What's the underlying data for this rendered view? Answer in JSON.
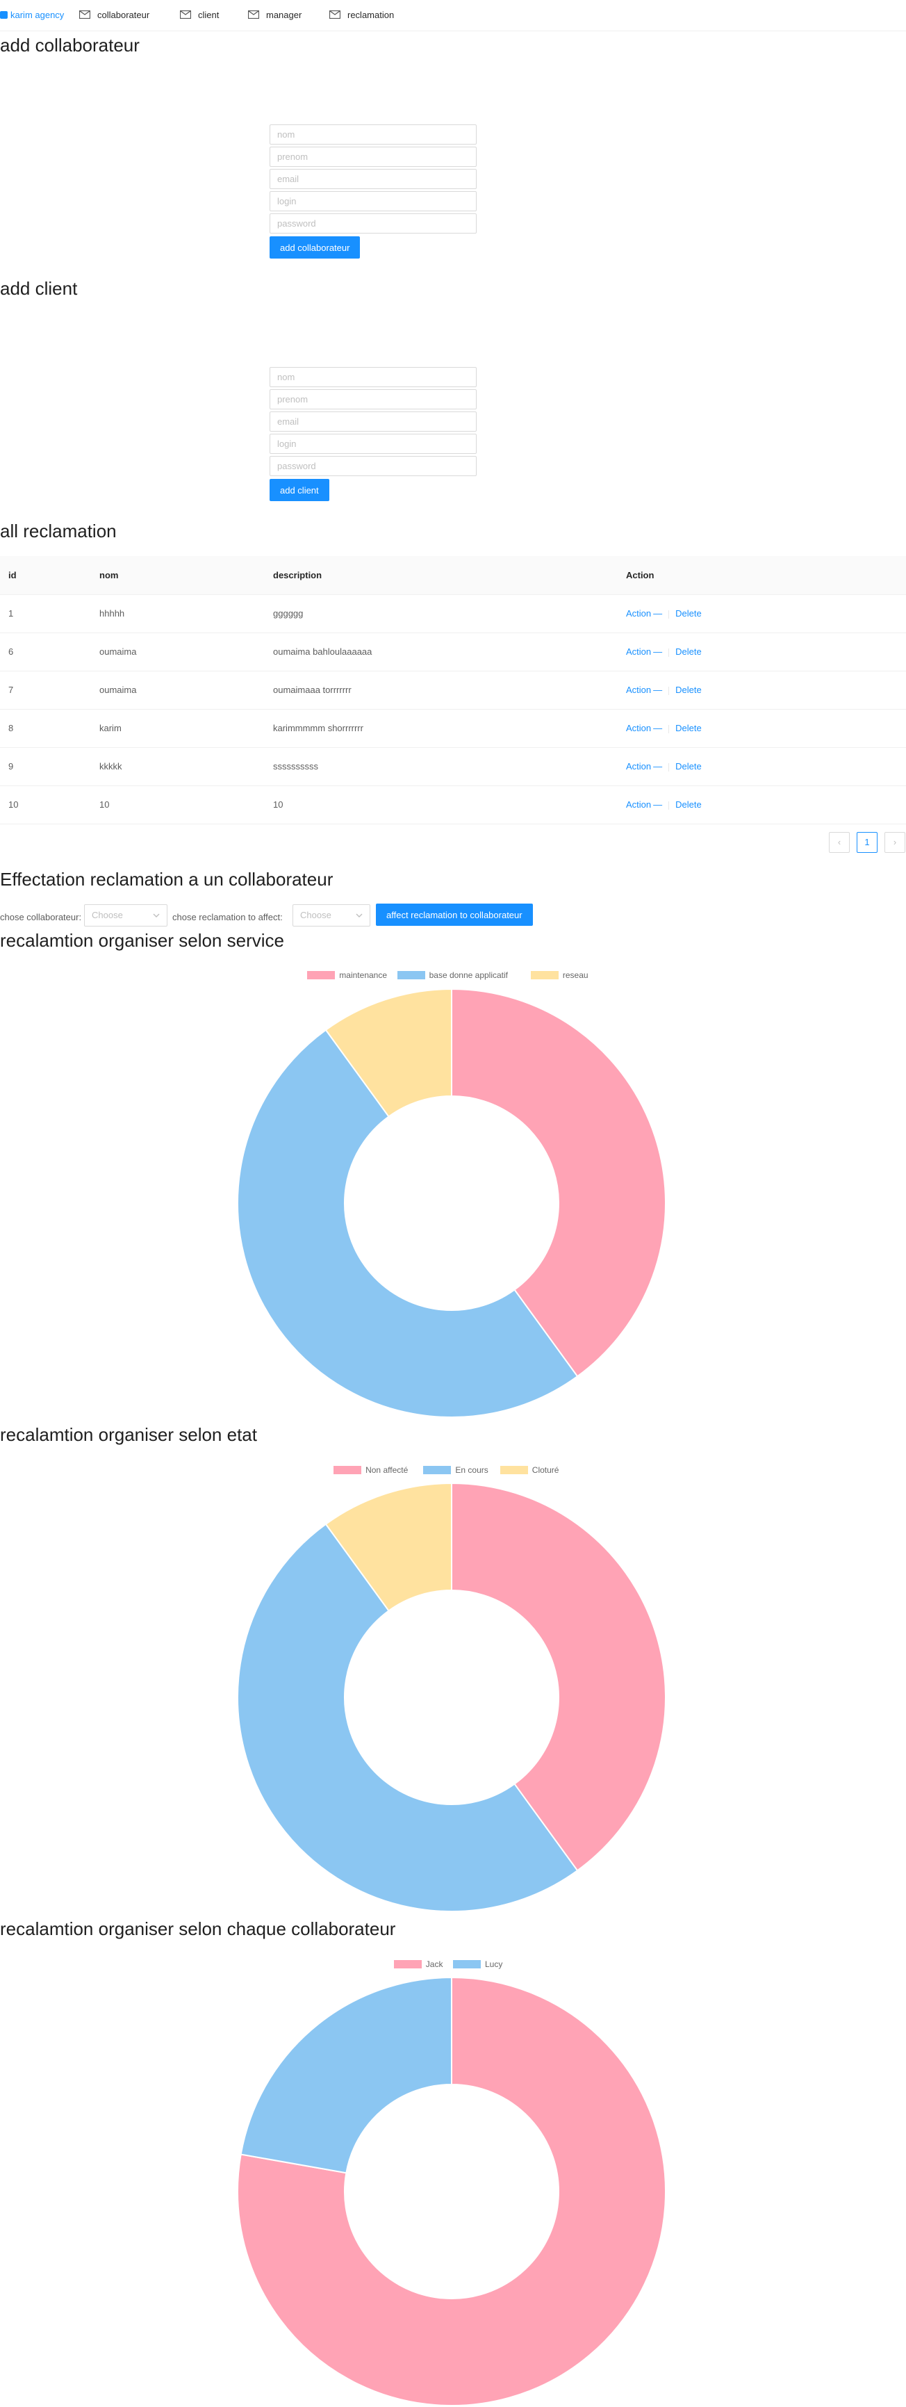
{
  "nav": {
    "brand": "karim agency",
    "items": [
      "collaborateur",
      "client",
      "manager",
      "reclamation"
    ]
  },
  "collab_form": {
    "title": "add collaborateur",
    "placeholders": {
      "nom": "nom",
      "prenom": "prenom",
      "email": "email",
      "login": "login",
      "password": "password"
    },
    "button": "add collaborateur"
  },
  "client_form": {
    "title": "add client",
    "placeholders": {
      "nom": "nom",
      "prenom": "prenom",
      "email": "email",
      "login": "login",
      "password": "password"
    },
    "button": "add client"
  },
  "reclamations": {
    "title": "all reclamation",
    "headers": {
      "id": "id",
      "nom": "nom",
      "description": "description",
      "action": "Action"
    },
    "action_label": "Action",
    "ellipsis": "—",
    "delete_label": "Delete",
    "rows": [
      {
        "id": "1",
        "nom": "hhhhh",
        "description": "gggggg"
      },
      {
        "id": "6",
        "nom": "oumaima",
        "description": "oumaima bahloulaaaaaa"
      },
      {
        "id": "7",
        "nom": "oumaima",
        "description": "oumaimaaa torrrrrrr"
      },
      {
        "id": "8",
        "nom": "karim",
        "description": "karimmmmm shorrrrrrr"
      },
      {
        "id": "9",
        "nom": "kkkkk",
        "description": "ssssssssss"
      },
      {
        "id": "10",
        "nom": "10",
        "description": "10"
      }
    ],
    "pagination": {
      "current": "1",
      "prev": "‹",
      "next": "›"
    }
  },
  "affectation": {
    "title": "Effectation reclamation a un collaborateur",
    "collab_label": "chose collaborateur:",
    "reclamation_label": "chose reclamation to affect:",
    "select_placeholder": "Choose",
    "button": "affect reclamation to collaborateur"
  },
  "chart_data": [
    {
      "type": "pie",
      "title": "recalamtion organiser selon service",
      "categories": [
        "maintenance",
        "base donne applicatif",
        "reseau"
      ],
      "values": [
        4,
        5,
        1
      ],
      "colors": [
        "#ffa3b5",
        "#8bc6f2",
        "#ffe29f"
      ]
    },
    {
      "type": "pie",
      "title": "recalamtion organiser selon etat",
      "categories": [
        "Non affecté",
        "En cours",
        "Cloturé"
      ],
      "values": [
        4,
        5,
        1
      ],
      "colors": [
        "#ffa3b5",
        "#8bc6f2",
        "#ffe29f"
      ]
    },
    {
      "type": "pie",
      "title": "recalamtion organiser selon chaque collaborateur",
      "categories": [
        "Jack",
        "Lucy"
      ],
      "values": [
        7,
        2
      ],
      "colors": [
        "#ffa3b5",
        "#8bc6f2"
      ]
    }
  ]
}
